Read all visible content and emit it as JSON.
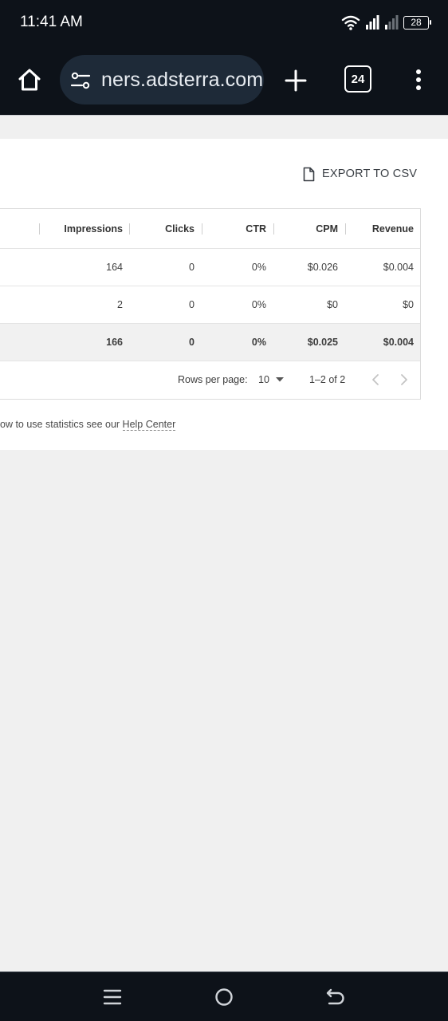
{
  "status_bar": {
    "time": "11:41 AM",
    "battery": "28",
    "icons": [
      "wifi-icon",
      "signal-icon",
      "signal-weak-icon",
      "battery-icon"
    ]
  },
  "browser": {
    "url": "ners.adsterra.com",
    "tab_count": "24",
    "icons": [
      "home-icon",
      "tune-icon",
      "plus-icon",
      "tabs-icon",
      "more-vert-icon"
    ]
  },
  "export": {
    "label": "EXPORT TO CSV",
    "icon": "file-icon"
  },
  "table": {
    "columns": [
      "Impressions",
      "Clicks",
      "CTR",
      "CPM",
      "Revenue"
    ],
    "rows": [
      {
        "impressions": "164",
        "clicks": "0",
        "ctr": "0%",
        "cpm": "$0.026",
        "revenue": "$0.004"
      },
      {
        "impressions": "2",
        "clicks": "0",
        "ctr": "0%",
        "cpm": "$0",
        "revenue": "$0"
      }
    ],
    "total": {
      "impressions": "166",
      "clicks": "0",
      "ctr": "0%",
      "cpm": "$0.025",
      "revenue": "$0.004"
    }
  },
  "pagination": {
    "rows_per_page_label": "Rows per page:",
    "rows_per_page_value": "10",
    "range": "1–2 of 2"
  },
  "help": {
    "prefix": "ow to use statistics see our ",
    "link": "Help Center"
  },
  "colors": {
    "chrome_bg": "#0d1219",
    "url_pill_bg": "#1e2a38",
    "page_bg": "#f0f0f0",
    "panel_bg": "#ffffff",
    "total_row_bg": "#f1f1f1"
  }
}
